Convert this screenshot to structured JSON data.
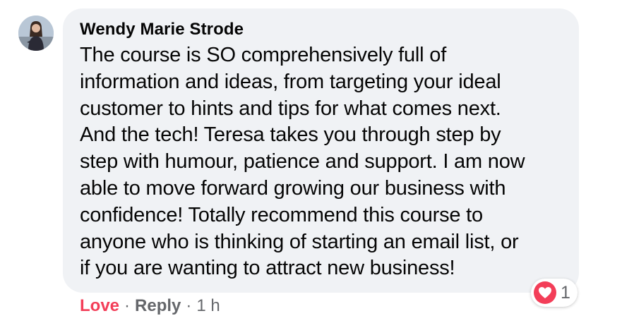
{
  "comment": {
    "author": "Wendy Marie Strode",
    "text": "The course is SO comprehensively full of\ninformation and ideas, from targeting your ideal\ncustomer to hints and tips for what comes next.\nAnd the tech! Teresa takes you through step by\nstep with humour, patience and support. I am now\nable to move forward growing our business with\nconfidence! Totally recommend this course to\nanyone who is thinking of starting an email list, or\nif you are wanting to attract new business!",
    "avatar_icon": "profile-photo",
    "reaction": {
      "icon": "heart-icon",
      "count": "1",
      "color": "#f33e58"
    }
  },
  "actions": {
    "love_label": "Love",
    "separator": "·",
    "reply_label": "Reply",
    "timestamp": "1 h"
  },
  "colors": {
    "bubble": "#f0f2f5",
    "text": "#050505",
    "secondary": "#65676b",
    "love": "#f33e58"
  }
}
